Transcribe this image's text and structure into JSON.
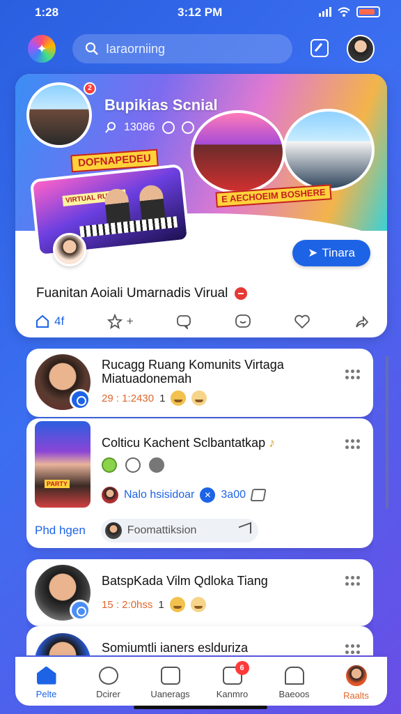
{
  "status": {
    "left_time": "1:28",
    "center_time": "3:12 PM"
  },
  "top_bar": {
    "search_placeholder": "Iaraorniing"
  },
  "hero": {
    "title": "Bupikias Scnial",
    "stats": "13086",
    "notification_count": "2",
    "tag_left": "DOFNAPEDEU",
    "tag_right": "E AECHOEIM BOSHERE",
    "stage_sign": "VIRTUAL RUANG",
    "share_label": "Tinara",
    "caption": "Fuanitan Aoiali Umarnadis Virual",
    "actions": {
      "first_count": "4f",
      "add": "+"
    }
  },
  "feed": {
    "card1": {
      "title_line1": "Rucagg Ruang Komunits Virtaga",
      "title_line2": "Miatuadonemah",
      "time": "29 : 1:2430",
      "count": "1"
    },
    "card2": {
      "title": "Colticu Kachent Sclbantatkap",
      "thumb_tag": "PARTY",
      "ref_name": "Nalo hsisidoar",
      "ref_count": "3a00",
      "reply_label": "Phd hgen",
      "reply_placeholder": "Foomattiksion"
    },
    "card3": {
      "title": "BatspKada Vilm Qdloka Tiang",
      "time": "15 : 2:0hss",
      "count": "1"
    },
    "card4": {
      "title": "Somiumtli ianers eslduriza"
    }
  },
  "tabs": [
    {
      "label": "Pelte"
    },
    {
      "label": "Dcirer"
    },
    {
      "label": "Uanerags"
    },
    {
      "label": "Kanmro",
      "badge": "6"
    },
    {
      "label": "Baeoos"
    },
    {
      "label": "Raalts"
    }
  ]
}
